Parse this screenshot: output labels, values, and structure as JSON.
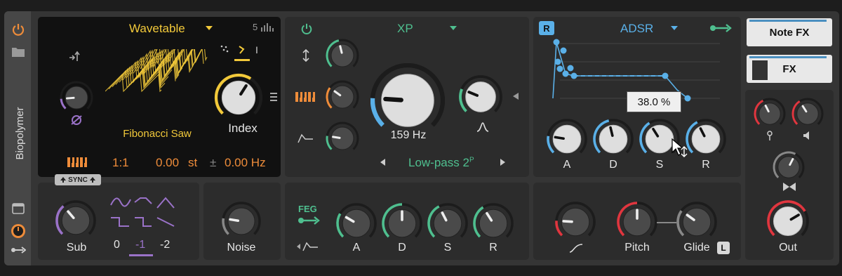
{
  "device": {
    "name": "Biopolymer"
  },
  "osc": {
    "type": "Wavetable",
    "wave_name": "Fibonacci Saw",
    "index_label": "Index",
    "ratio": "1:1",
    "semitones": "0.00",
    "st_unit": "st",
    "plusminus": "±",
    "hz_offset": "0.00 Hz",
    "sync_label": "SYNC",
    "bank_number": "5",
    "index_symbol": "I"
  },
  "sub": {
    "label": "Sub",
    "octaves": [
      "0",
      "-1",
      "-2"
    ],
    "selected": "-1"
  },
  "noise": {
    "label": "Noise"
  },
  "filter": {
    "type": "XP",
    "freq": "159 Hz",
    "mode": "Low-pass 2",
    "mode_sup": "P"
  },
  "feg": {
    "label": "FEG",
    "knobs": [
      "A",
      "D",
      "S",
      "R"
    ]
  },
  "amp": {
    "mode_badge": "R",
    "type": "ADSR",
    "knobs": [
      "A",
      "D",
      "S",
      "R"
    ],
    "tooltip": "38.0 %"
  },
  "mod": {
    "pitch_label": "Pitch",
    "glide_label": "Glide",
    "badge": "L"
  },
  "fx": {
    "note_fx": "Note FX",
    "fx": "FX",
    "out": "Out"
  },
  "colors": {
    "orange": "#ee8c3a",
    "yellow": "#f2c93a",
    "green": "#4fbf8f",
    "blue": "#5ab0e8",
    "red": "#e0363f",
    "purple": "#9a72c8"
  },
  "knobs": {
    "osc_small": 0.15,
    "index": 0.62,
    "filter_1": 0.45,
    "filter_2": 0.3,
    "filter_3": 0.2,
    "cutoff": 0.18,
    "resonance": 0.25,
    "amp_a": 0.2,
    "amp_d": 0.45,
    "amp_s": 0.38,
    "amp_r": 0.4,
    "sub": 0.35,
    "noise": 0.2,
    "feg_a": 0.28,
    "feg_d": 0.5,
    "feg_s": 0.4,
    "feg_r": 0.38,
    "shape": 0.18,
    "pitch": 0.5,
    "glide": 0.3,
    "fx_1": 0.4,
    "fx_2": 0.38,
    "fx_3": 0.6,
    "out": 0.72
  }
}
